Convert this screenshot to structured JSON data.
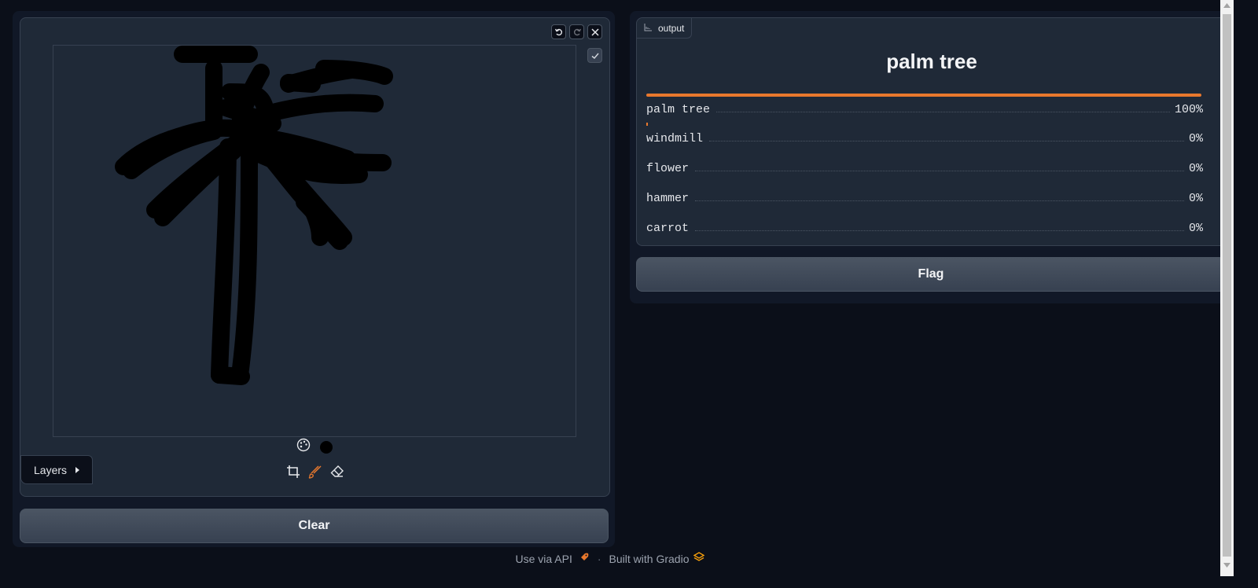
{
  "sketchpad": {
    "undo_icon": "undo-icon",
    "redo_icon": "redo-icon",
    "close_icon": "close-icon",
    "confirm_icon": "check-icon",
    "brush_color": "#000000",
    "layers_label": "Layers",
    "tools": [
      "crop-icon",
      "brush-icon",
      "eraser-icon"
    ]
  },
  "clear_label": "Clear",
  "output": {
    "label": "output",
    "prediction": "palm tree",
    "accent": "#e8782d",
    "confidences": [
      {
        "label": "palm tree",
        "value": "100%",
        "fraction": 1.0
      },
      {
        "label": "windmill",
        "value": "0%",
        "fraction": 0.0
      },
      {
        "label": "flower",
        "value": "0%",
        "fraction": 0.0
      },
      {
        "label": "hammer",
        "value": "0%",
        "fraction": 0.0
      },
      {
        "label": "carrot",
        "value": "0%",
        "fraction": 0.0
      }
    ]
  },
  "flag_label": "Flag",
  "footer": {
    "api_label": "Use via API",
    "separator": "·",
    "built_label": "Built with Gradio"
  }
}
